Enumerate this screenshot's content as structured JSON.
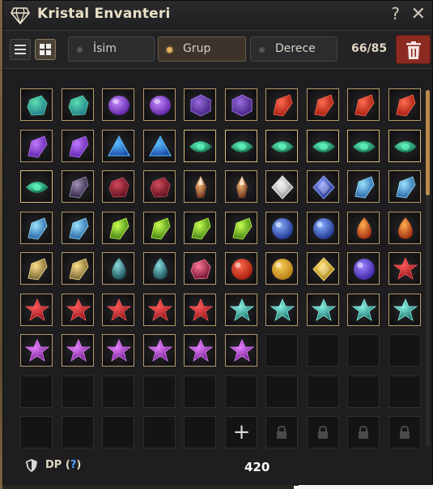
{
  "window": {
    "title": "Kristal Envanteri",
    "help": "?",
    "close": "✕"
  },
  "toolbar": {
    "tabs": [
      {
        "label": "İsim",
        "active": false
      },
      {
        "label": "Grup",
        "active": true
      },
      {
        "label": "Derece",
        "active": false
      }
    ],
    "count": "66/85"
  },
  "footer": {
    "dp_label": "DP",
    "dp_help": "?",
    "dp_value": "420"
  },
  "grid": {
    "columns": 10,
    "rows": 9,
    "add_symbol": "+",
    "items": [
      "green-crystal",
      "green-crystal",
      "purple-gem",
      "purple-gem",
      "purple-hex",
      "purple-hex",
      "red-shard",
      "red-shard",
      "red-shard",
      "red-shard",
      "purple-shard",
      "purple-shard",
      "blue-triangle",
      "blue-triangle",
      "emerald-eye",
      "emerald-eye",
      "emerald-eye",
      "emerald-eye",
      "emerald-eye",
      "emerald-eye",
      "emerald-eye",
      "dark-shard",
      "crimson-shard",
      "crimson-shard",
      "orange-spike",
      "orange-spike",
      "white-diamond",
      "navy-diamond",
      "ice-shard",
      "ice-shard",
      "ice-shard",
      "ice-shard",
      "lime-shard",
      "lime-shard",
      "lime-shard",
      "lime-shard",
      "blue-orb",
      "blue-orb",
      "fire-drop",
      "fire-drop",
      "gold-shard",
      "gold-shard",
      "teal-drop",
      "teal-drop",
      "ruby-shard",
      "red-orb",
      "gold-orb",
      "gold-diamond",
      "violet-orb",
      "red-star",
      "red-star",
      "red-star",
      "red-star",
      "red-star",
      "red-star",
      "teal-star",
      "teal-star",
      "teal-star",
      "teal-star",
      "teal-star",
      "magenta-star",
      "magenta-star",
      "magenta-star",
      "magenta-star",
      "magenta-star",
      "magenta-star"
    ],
    "gold_border_indices": [
      14,
      15,
      16,
      17,
      18,
      19,
      20
    ],
    "add_slot_index": 85,
    "locked_indices": [
      86,
      87,
      88,
      89
    ]
  },
  "colors": {
    "accent": "#b98b4a",
    "trash": "#8c2a22",
    "border_gold": "#d7bd73"
  }
}
